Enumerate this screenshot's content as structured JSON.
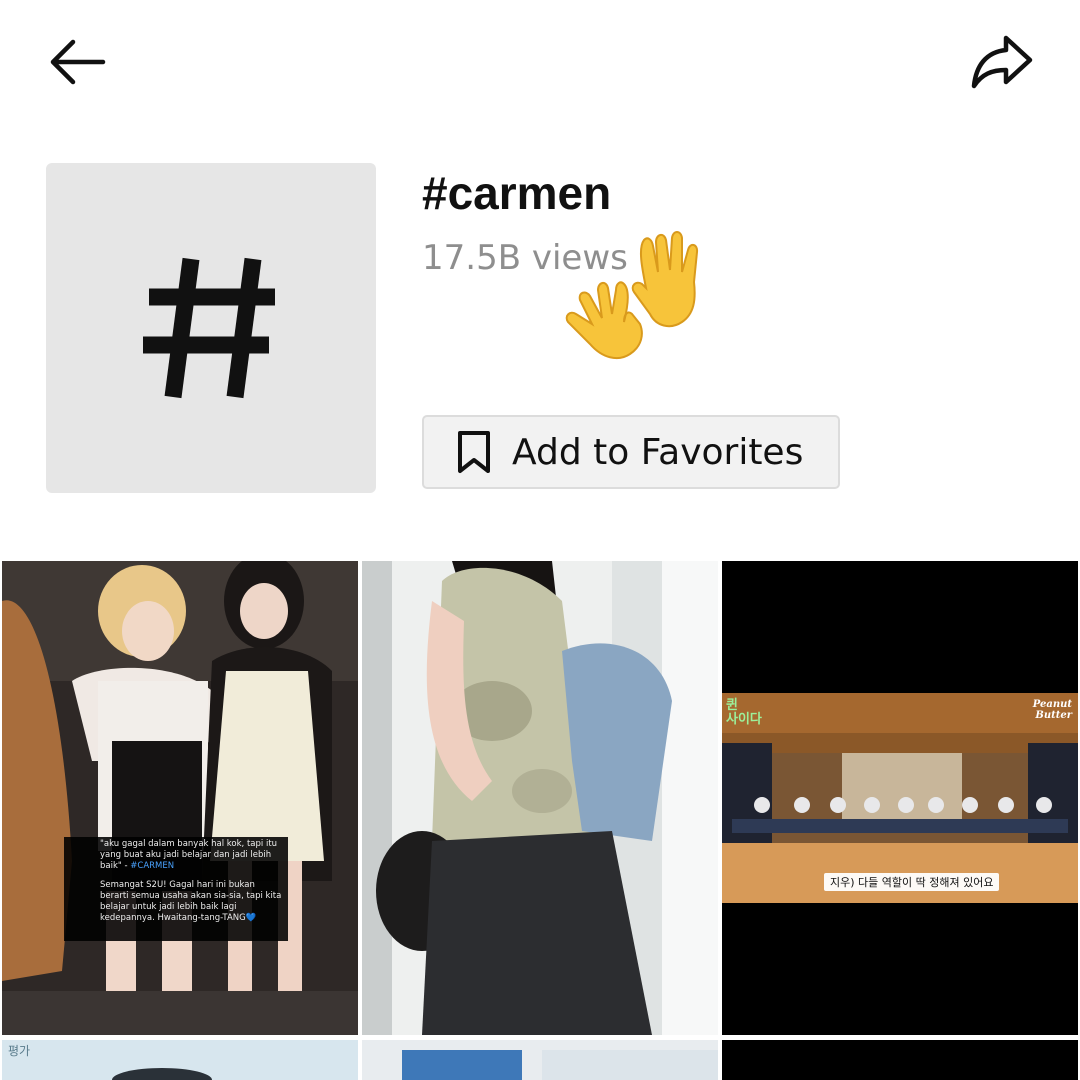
{
  "hashtag": {
    "title": "#carmen",
    "views": "17.5B views",
    "symbol": "#"
  },
  "actions": {
    "favorites_label": "Add to Favorites"
  },
  "icons": {
    "back": "back-arrow-icon",
    "share": "share-arrow-icon",
    "bookmark": "bookmark-icon",
    "clap": "raised-hands-emoji"
  },
  "videos": [
    {
      "caption_quote": "\"aku gagal dalam banyak hal kok, tapi itu yang buat aku jadi belajar dan jadi lebih baik\" - ",
      "caption_hashtag": "#CARMEN",
      "caption_message": "Semangat S2U! Gagal hari ini bukan berarti semua usaha akan sia-sia, tapi kita belajar untuk jadi lebih baik lagi kedepannya. Hwaitang-tang-TANG💙"
    },
    {},
    {
      "logo_left_1": "퀸",
      "logo_left_2": "사이다",
      "logo_right_1": "Peanut",
      "logo_right_2": "Butter",
      "subtitle": "지우) 다들 역할이 딱 정해져 있어요"
    },
    {
      "corner_text": "평가"
    },
    {},
    {}
  ],
  "colors": {
    "tile_bg": "#e6e6e6",
    "views_text": "#8e8e8e",
    "button_bg": "#f2f2f2",
    "caption_hashtag": "#4aa3ff"
  }
}
